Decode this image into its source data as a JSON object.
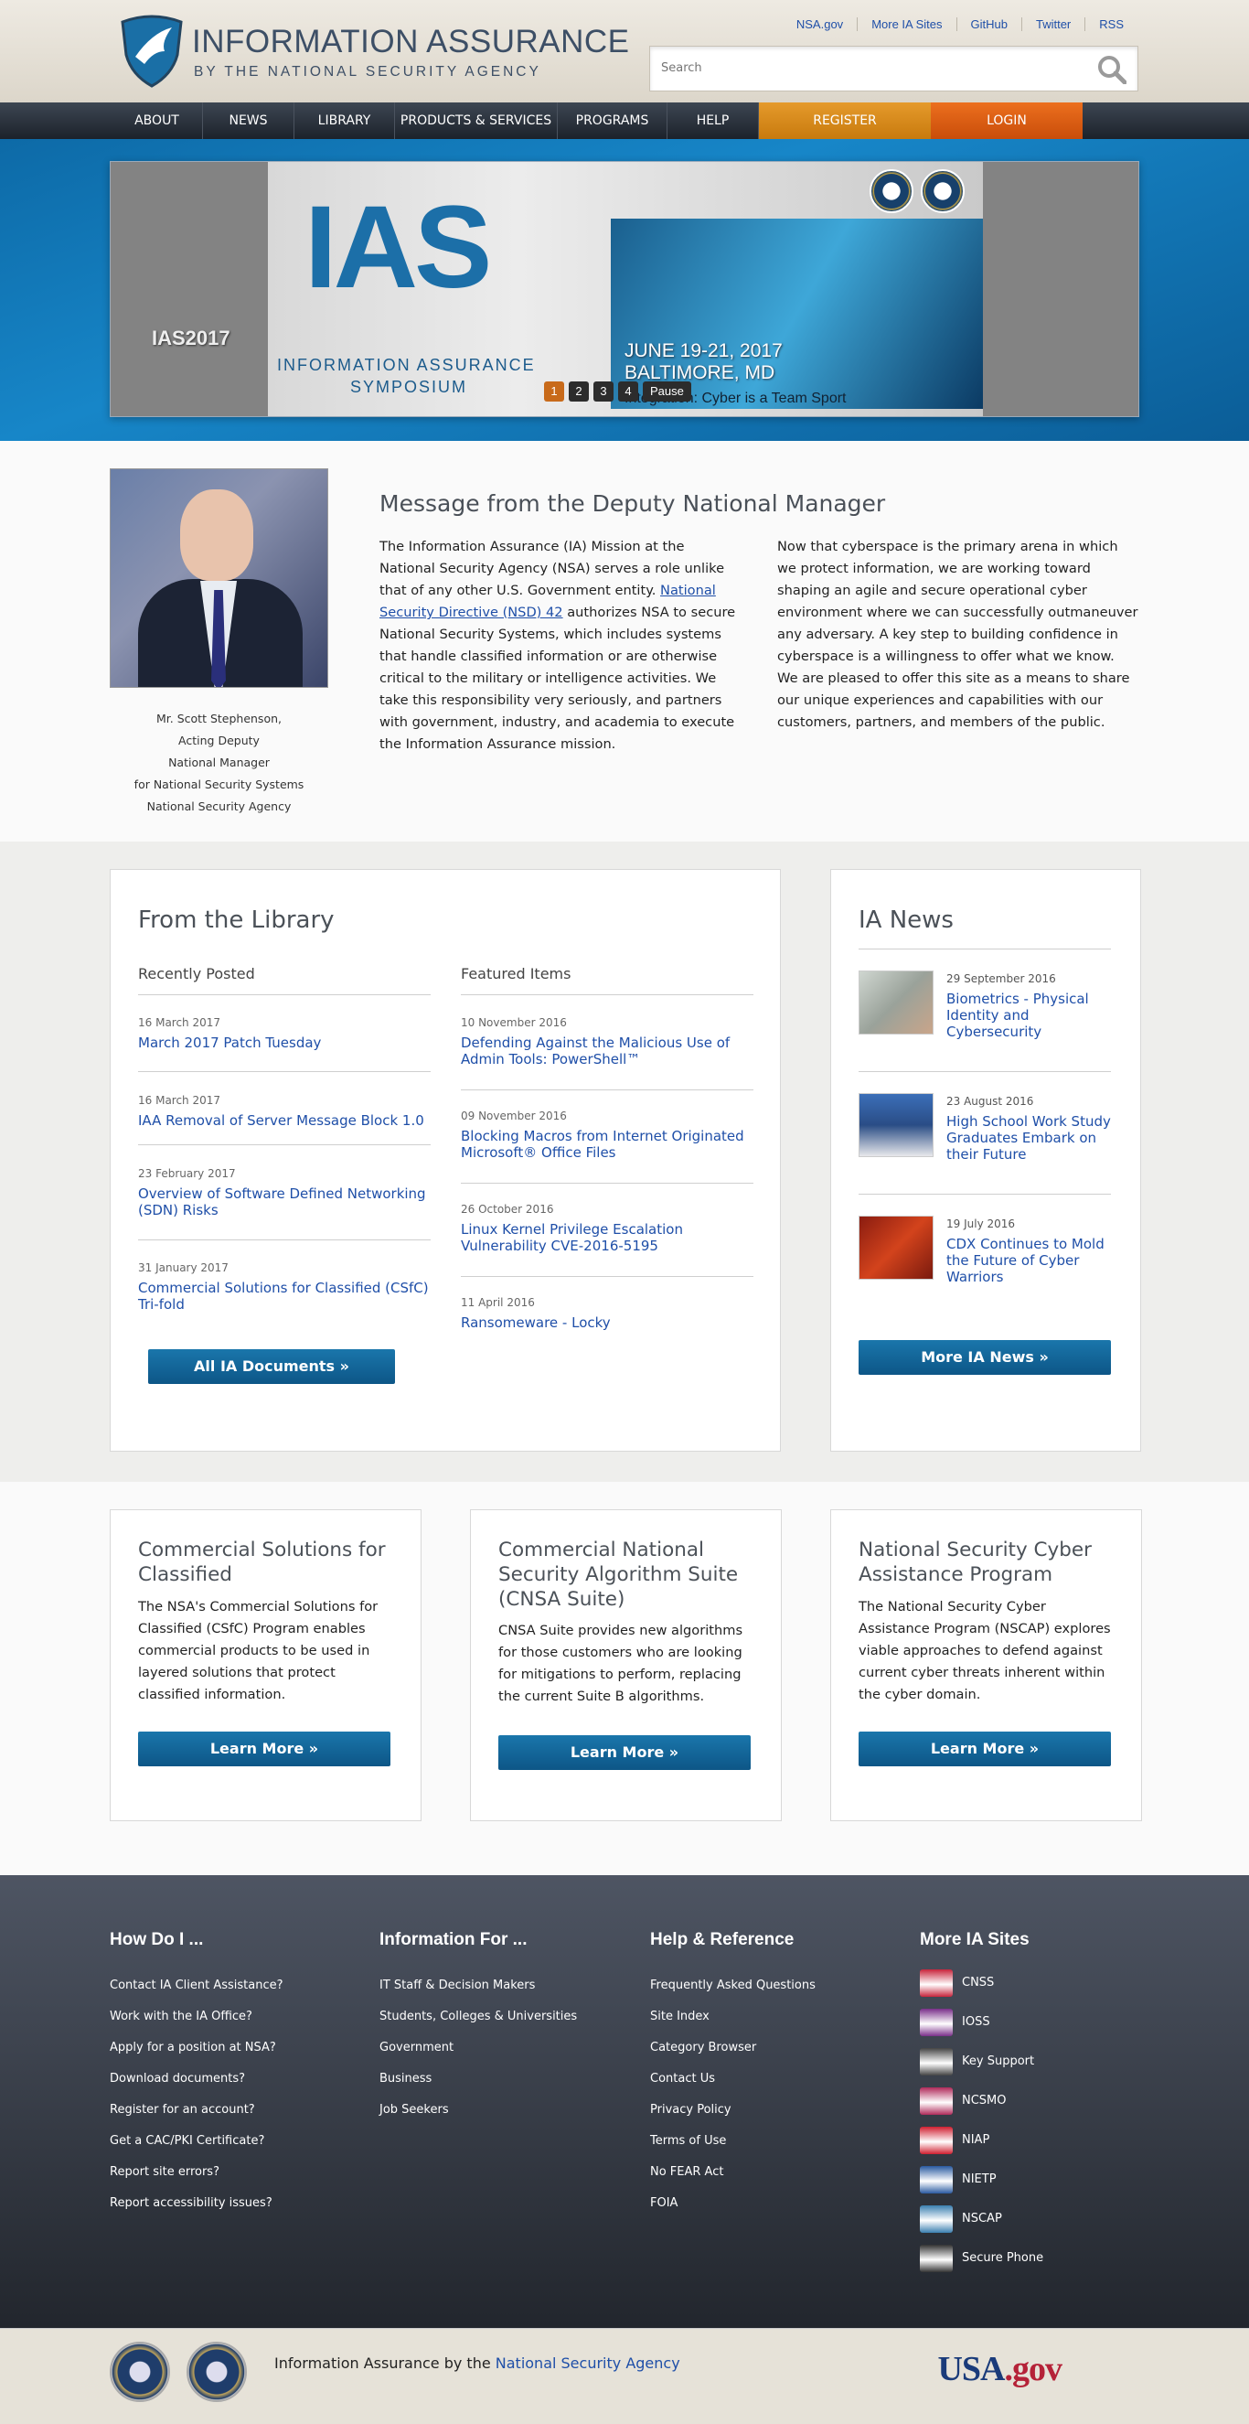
{
  "header": {
    "logo_title": "INFORMATION ASSURANCE",
    "logo_subtitle": "BY THE NATIONAL SECURITY AGENCY",
    "top_links": [
      "NSA.gov",
      "More IA Sites",
      "GitHub",
      "Twitter",
      "RSS"
    ],
    "search_placeholder": "Search"
  },
  "nav": {
    "items": [
      "ABOUT",
      "NEWS",
      "LIBRARY",
      "PRODUCTS & SERVICES",
      "PROGRAMS",
      "HELP"
    ],
    "register": "REGISTER",
    "login": "LOGIN"
  },
  "hero": {
    "left_label": "IAS2017",
    "logo": "IAS",
    "line1": "INFORMATION ASSURANCE",
    "line2": "SYMPOSIUM",
    "date1": "JUNE 19-21, 2017",
    "date2": "BALTIMORE, MD",
    "tagline": "Integration: Cyber is a Team Sport",
    "pager": [
      "1",
      "2",
      "3",
      "4"
    ],
    "pause": "Pause",
    "active_slide": 1
  },
  "message": {
    "title": "Message from the Deputy National Manager",
    "caption": [
      "Mr. Scott Stephenson,",
      "Acting Deputy",
      "National Manager",
      "for National Security Systems",
      "National Security Agency"
    ],
    "col1_before": "The Information Assurance (IA) Mission at the National Security Agency (NSA) serves a role unlike that of any other U.S. Government entity. ",
    "col1_link": "National Security Directive (NSD) 42",
    "col1_after": " authorizes NSA to secure National Security Systems, which includes systems that handle classified information or are otherwise critical to the military or intelligence activities. We take this responsibility very seriously, and partners with government, industry, and academia to execute the Information Assurance mission.",
    "col2": "Now that cyberspace is the primary arena in which we protect information, we are working toward shaping an agile and secure operational cyber environment where we can successfully outmaneuver any adversary. A key step to building confidence in cyberspace is a willingness to offer what we know. We are pleased to offer this site as a means to share our unique experiences and capabilities with our customers, partners, and members of the public."
  },
  "library": {
    "title": "From the Library",
    "recent_heading": "Recently Posted",
    "featured_heading": "Featured Items",
    "recent": [
      {
        "date": "16 March 2017",
        "title": "March 2017 Patch Tuesday"
      },
      {
        "date": "16 March 2017",
        "title": "IAA Removal of Server Message Block 1.0"
      },
      {
        "date": "23 February 2017",
        "title": "Overview of Software Defined Networking (SDN) Risks"
      },
      {
        "date": "31 January 2017",
        "title": "Commercial Solutions for Classified (CSfC) Tri-fold"
      }
    ],
    "featured": [
      {
        "date": "10 November 2016",
        "title": "Defending Against the Malicious Use of Admin Tools: PowerShell™"
      },
      {
        "date": "09 November 2016",
        "title": "Blocking Macros from Internet Originated Microsoft® Office Files"
      },
      {
        "date": "26 October 2016",
        "title": "Linux Kernel Privilege Escalation Vulnerability CVE-2016-5195"
      },
      {
        "date": "11 April 2016",
        "title": "Ransomeware - Locky"
      }
    ],
    "button": "All IA Documents »"
  },
  "news": {
    "title": "IA News",
    "items": [
      {
        "date": "29 September 2016",
        "title": "Biometrics - Physical Identity and Cybersecurity"
      },
      {
        "date": "23 August 2016",
        "title": "High School Work Study Graduates Embark on their Future"
      },
      {
        "date": "19 July 2016",
        "title": "CDX Continues to Mold the Future of Cyber Warriors"
      }
    ],
    "button": "More IA News »"
  },
  "programs": [
    {
      "title": "Commercial Solutions for Classified",
      "text": "The NSA's Commercial Solutions for Classified (CSfC) Program enables commercial products to be used in layered solutions that protect classified information.",
      "button": "Learn More »"
    },
    {
      "title": "Commercial National Security Algorithm Suite (CNSA Suite)",
      "text": "CNSA Suite provides new algorithms for those customers who are looking for mitigations to perform, replacing the current Suite B algorithms.",
      "button": "Learn More »"
    },
    {
      "title": "National Security Cyber Assistance Program",
      "text": "The National Security Cyber Assistance Program (NSCAP) explores viable approaches to defend against current cyber threats inherent within the cyber domain.",
      "button": "Learn More »"
    }
  ],
  "footer": {
    "cols": [
      {
        "title": "How Do I ...",
        "links": [
          "Contact IA Client Assistance?",
          "Work with the IA Office?",
          "Apply for a position at NSA?",
          "Download documents?",
          "Register for an account?",
          "Get a CAC/PKI Certificate?",
          "Report site errors?",
          "Report accessibility issues?"
        ]
      },
      {
        "title": "Information For ...",
        "links": [
          "IT Staff & Decision Makers",
          "Students, Colleges & Universities",
          "Government",
          "Business",
          "Job Seekers"
        ]
      },
      {
        "title": "Help & Reference",
        "links": [
          "Frequently Asked Questions",
          "Site Index",
          "Category Browser",
          "Contact Us",
          "Privacy Policy",
          "Terms of Use",
          "No FEAR Act",
          "FOIA"
        ]
      }
    ],
    "sites_title": "More IA Sites",
    "sites": [
      "CNSS",
      "IOSS",
      "Key Support",
      "NCSMO",
      "NIAP",
      "NIETP",
      "NSCAP",
      "Secure Phone"
    ],
    "site_colors": [
      "#c8243b",
      "#7a2f8a",
      "#444444",
      "#b02a5a",
      "#d01f30",
      "#2a5aa0",
      "#3a7fb0",
      "#333333"
    ]
  },
  "bottom": {
    "text": "Information Assurance by the ",
    "link": "National Security Agency",
    "usa_a": "USA",
    "usa_b": ".gov"
  }
}
